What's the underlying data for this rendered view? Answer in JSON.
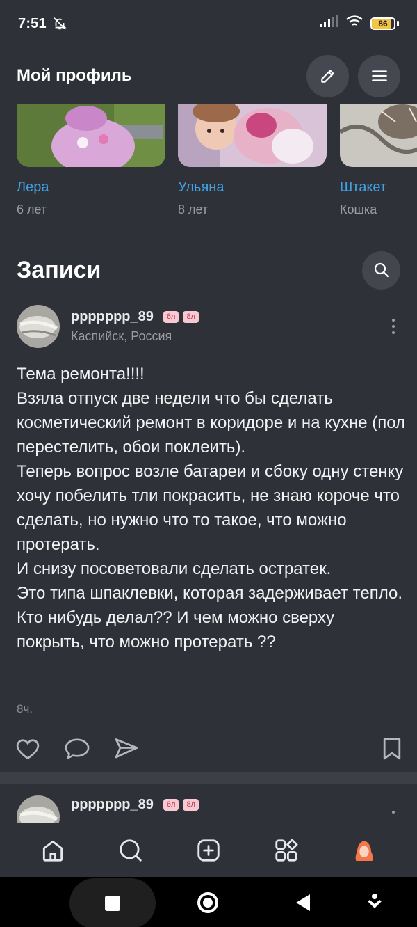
{
  "status_bar": {
    "time": "7:51",
    "battery": "86"
  },
  "header": {
    "title": "Мой профиль"
  },
  "pets": [
    {
      "name": "Лера",
      "age": "6 лет"
    },
    {
      "name": "Ульяна",
      "age": "8 лет"
    },
    {
      "name": "Штакет",
      "age": "Кошка"
    }
  ],
  "section": {
    "title": "Записи"
  },
  "post": {
    "author": "ppppppp_89",
    "badges": [
      "6л",
      "8л"
    ],
    "location": "Каспийск, Россия",
    "text": "Тема ремонта!!!!\nВзяла отпуск две недели что бы сделать косметический ремонт в коридоре и на кухне (пол перестелить, обои поклеить).\nТеперь вопрос возле батареи и сбоку одну стенку хочу побелить тли покрасить, не знаю короче что сделать, но нужно что то такое, что можно протерать.\nИ снизу посоветовали сделать остратек.\nЭто типа шпаклевки, которая задерживает тепло.\nКто нибудь делал?? И чем можно сверху покрыть, что можно протерать ??",
    "time": "8ч."
  },
  "post2": {
    "author": "ppppppp_89",
    "badges": [
      "6л",
      "8л"
    ]
  },
  "bottom_nav": [
    "home-icon",
    "search-icon",
    "add-icon",
    "services-icon",
    "profile-avatar-icon"
  ],
  "colors": {
    "background": "#2e3137",
    "accent": "#41a3e6",
    "avatar_accent": "#f2774a"
  }
}
